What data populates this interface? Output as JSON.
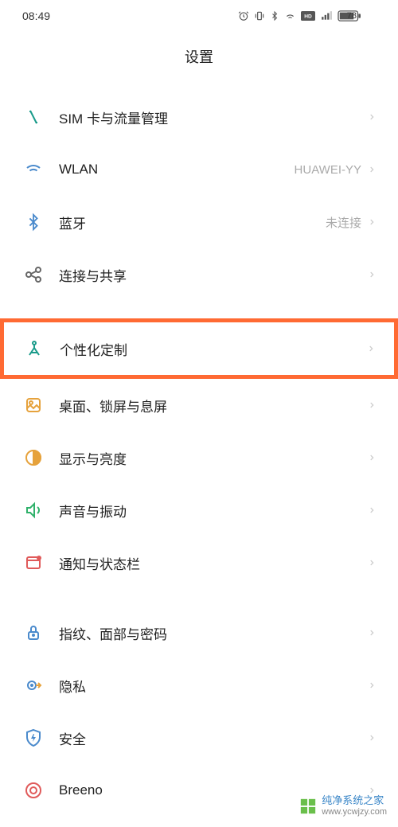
{
  "status": {
    "time": "08:49",
    "battery": "78"
  },
  "header": {
    "title": "设置"
  },
  "groups": [
    {
      "items": [
        {
          "id": "sim",
          "icon": "sim-icon",
          "label": "SIM 卡与流量管理",
          "value": "",
          "highlighted": false
        },
        {
          "id": "wlan",
          "icon": "wifi-icon",
          "label": "WLAN",
          "value": "HUAWEI-YY",
          "highlighted": false
        },
        {
          "id": "bluetooth",
          "icon": "bluetooth-icon",
          "label": "蓝牙",
          "value": "未连接",
          "highlighted": false
        },
        {
          "id": "sharing",
          "icon": "sharing-icon",
          "label": "连接与共享",
          "value": "",
          "highlighted": false
        }
      ]
    },
    {
      "items": [
        {
          "id": "personalization",
          "icon": "personalization-icon",
          "label": "个性化定制",
          "value": "",
          "highlighted": true
        },
        {
          "id": "desktop",
          "icon": "desktop-icon",
          "label": "桌面、锁屏与息屏",
          "value": "",
          "highlighted": false
        },
        {
          "id": "display",
          "icon": "display-icon",
          "label": "显示与亮度",
          "value": "",
          "highlighted": false
        },
        {
          "id": "sound",
          "icon": "sound-icon",
          "label": "声音与振动",
          "value": "",
          "highlighted": false
        },
        {
          "id": "notification",
          "icon": "notification-icon",
          "label": "通知与状态栏",
          "value": "",
          "highlighted": false
        }
      ]
    },
    {
      "items": [
        {
          "id": "biometric",
          "icon": "lock-icon",
          "label": "指纹、面部与密码",
          "value": "",
          "highlighted": false
        },
        {
          "id": "privacy",
          "icon": "privacy-icon",
          "label": "隐私",
          "value": "",
          "highlighted": false
        },
        {
          "id": "security",
          "icon": "security-icon",
          "label": "安全",
          "value": "",
          "highlighted": false
        },
        {
          "id": "breeno",
          "icon": "breeno-icon",
          "label": "Breeno",
          "value": "",
          "highlighted": false
        }
      ]
    }
  ],
  "watermark": {
    "brand": "纯净系统之家",
    "url": "www.ycwjzy.com"
  },
  "colors": {
    "teal": "#1a9b8a",
    "blue": "#4a8acc",
    "orange": "#e6a23c",
    "green": "#2fb16a",
    "red": "#e05a5a"
  }
}
